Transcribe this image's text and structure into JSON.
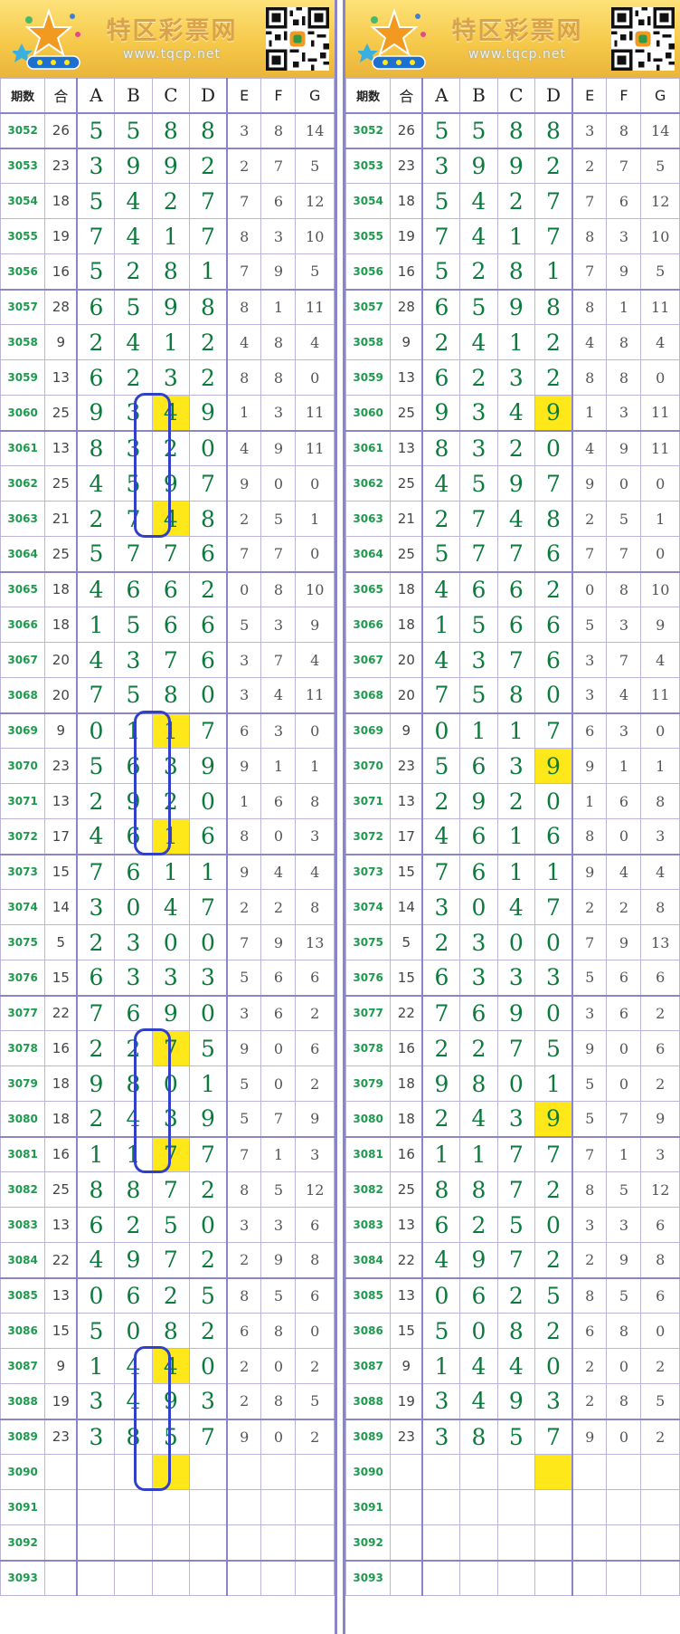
{
  "site": {
    "name": "特区彩票网",
    "url": "www.tqcp.net"
  },
  "headers": [
    "期数",
    "合",
    "A",
    "B",
    "C",
    "D",
    "E",
    "F",
    "G"
  ],
  "colors": {
    "accent_border": "#8a84c8",
    "highlight": "#ffe81a",
    "oval": "#3040c8",
    "period": "#1e9a4e",
    "digit": "#0c7a3c"
  },
  "rows": [
    {
      "p": "3052",
      "s": "26",
      "v": [
        "5",
        "5",
        "8",
        "8",
        "3",
        "8",
        "14"
      ]
    },
    {
      "p": "3053",
      "s": "23",
      "v": [
        "3",
        "9",
        "9",
        "2",
        "2",
        "7",
        "5"
      ]
    },
    {
      "p": "3054",
      "s": "18",
      "v": [
        "5",
        "4",
        "2",
        "7",
        "7",
        "6",
        "12"
      ]
    },
    {
      "p": "3055",
      "s": "19",
      "v": [
        "7",
        "4",
        "1",
        "7",
        "8",
        "3",
        "10"
      ]
    },
    {
      "p": "3056",
      "s": "16",
      "v": [
        "5",
        "2",
        "8",
        "1",
        "7",
        "9",
        "5"
      ]
    },
    {
      "p": "3057",
      "s": "28",
      "v": [
        "6",
        "5",
        "9",
        "8",
        "8",
        "1",
        "11"
      ]
    },
    {
      "p": "3058",
      "s": "9",
      "v": [
        "2",
        "4",
        "1",
        "2",
        "4",
        "8",
        "4"
      ]
    },
    {
      "p": "3059",
      "s": "13",
      "v": [
        "6",
        "2",
        "3",
        "2",
        "8",
        "8",
        "0"
      ]
    },
    {
      "p": "3060",
      "s": "25",
      "v": [
        "9",
        "3",
        "4",
        "9",
        "1",
        "3",
        "11"
      ]
    },
    {
      "p": "3061",
      "s": "13",
      "v": [
        "8",
        "3",
        "2",
        "0",
        "4",
        "9",
        "11"
      ]
    },
    {
      "p": "3062",
      "s": "25",
      "v": [
        "4",
        "5",
        "9",
        "7",
        "9",
        "0",
        "0"
      ]
    },
    {
      "p": "3063",
      "s": "21",
      "v": [
        "2",
        "7",
        "4",
        "8",
        "2",
        "5",
        "1"
      ]
    },
    {
      "p": "3064",
      "s": "25",
      "v": [
        "5",
        "7",
        "7",
        "6",
        "7",
        "7",
        "0"
      ]
    },
    {
      "p": "3065",
      "s": "18",
      "v": [
        "4",
        "6",
        "6",
        "2",
        "0",
        "8",
        "10"
      ]
    },
    {
      "p": "3066",
      "s": "18",
      "v": [
        "1",
        "5",
        "6",
        "6",
        "5",
        "3",
        "9"
      ]
    },
    {
      "p": "3067",
      "s": "20",
      "v": [
        "4",
        "3",
        "7",
        "6",
        "3",
        "7",
        "4"
      ]
    },
    {
      "p": "3068",
      "s": "20",
      "v": [
        "7",
        "5",
        "8",
        "0",
        "3",
        "4",
        "11"
      ]
    },
    {
      "p": "3069",
      "s": "9",
      "v": [
        "0",
        "1",
        "1",
        "7",
        "6",
        "3",
        "0"
      ]
    },
    {
      "p": "3070",
      "s": "23",
      "v": [
        "5",
        "6",
        "3",
        "9",
        "9",
        "1",
        "1"
      ]
    },
    {
      "p": "3071",
      "s": "13",
      "v": [
        "2",
        "9",
        "2",
        "0",
        "1",
        "6",
        "8"
      ]
    },
    {
      "p": "3072",
      "s": "17",
      "v": [
        "4",
        "6",
        "1",
        "6",
        "8",
        "0",
        "3"
      ]
    },
    {
      "p": "3073",
      "s": "15",
      "v": [
        "7",
        "6",
        "1",
        "1",
        "9",
        "4",
        "4"
      ]
    },
    {
      "p": "3074",
      "s": "14",
      "v": [
        "3",
        "0",
        "4",
        "7",
        "2",
        "2",
        "8"
      ]
    },
    {
      "p": "3075",
      "s": "5",
      "v": [
        "2",
        "3",
        "0",
        "0",
        "7",
        "9",
        "13"
      ]
    },
    {
      "p": "3076",
      "s": "15",
      "v": [
        "6",
        "3",
        "3",
        "3",
        "5",
        "6",
        "6"
      ]
    },
    {
      "p": "3077",
      "s": "22",
      "v": [
        "7",
        "6",
        "9",
        "0",
        "3",
        "6",
        "2"
      ]
    },
    {
      "p": "3078",
      "s": "16",
      "v": [
        "2",
        "2",
        "7",
        "5",
        "9",
        "0",
        "6"
      ]
    },
    {
      "p": "3079",
      "s": "18",
      "v": [
        "9",
        "8",
        "0",
        "1",
        "5",
        "0",
        "2"
      ]
    },
    {
      "p": "3080",
      "s": "18",
      "v": [
        "2",
        "4",
        "3",
        "9",
        "5",
        "7",
        "9"
      ]
    },
    {
      "p": "3081",
      "s": "16",
      "v": [
        "1",
        "1",
        "7",
        "7",
        "7",
        "1",
        "3"
      ]
    },
    {
      "p": "3082",
      "s": "25",
      "v": [
        "8",
        "8",
        "7",
        "2",
        "8",
        "5",
        "12"
      ]
    },
    {
      "p": "3083",
      "s": "13",
      "v": [
        "6",
        "2",
        "5",
        "0",
        "3",
        "3",
        "6"
      ]
    },
    {
      "p": "3084",
      "s": "22",
      "v": [
        "4",
        "9",
        "7",
        "2",
        "2",
        "9",
        "8"
      ]
    },
    {
      "p": "3085",
      "s": "13",
      "v": [
        "0",
        "6",
        "2",
        "5",
        "8",
        "5",
        "6"
      ]
    },
    {
      "p": "3086",
      "s": "15",
      "v": [
        "5",
        "0",
        "8",
        "2",
        "6",
        "8",
        "0"
      ]
    },
    {
      "p": "3087",
      "s": "9",
      "v": [
        "1",
        "4",
        "4",
        "0",
        "2",
        "0",
        "2"
      ]
    },
    {
      "p": "3088",
      "s": "19",
      "v": [
        "3",
        "4",
        "9",
        "3",
        "2",
        "8",
        "5"
      ]
    },
    {
      "p": "3089",
      "s": "23",
      "v": [
        "3",
        "8",
        "5",
        "7",
        "9",
        "0",
        "2"
      ]
    },
    {
      "p": "3090",
      "s": "",
      "v": [
        "",
        "",
        "",
        "",
        "",
        "",
        ""
      ]
    },
    {
      "p": "3091",
      "s": "",
      "v": [
        "",
        "",
        "",
        "",
        "",
        "",
        ""
      ]
    },
    {
      "p": "3092",
      "s": "",
      "v": [
        "",
        "",
        "",
        "",
        "",
        "",
        ""
      ]
    },
    {
      "p": "3093",
      "s": "",
      "v": [
        "",
        "",
        "",
        "",
        "",
        "",
        ""
      ]
    }
  ],
  "highlights_left": [
    [
      8,
      4
    ],
    [
      11,
      4
    ],
    [
      17,
      4
    ],
    [
      20,
      4
    ],
    [
      26,
      4
    ],
    [
      29,
      4
    ],
    [
      35,
      4
    ],
    [
      38,
      4
    ]
  ],
  "highlights_right": [
    [
      8,
      5
    ],
    [
      18,
      5
    ],
    [
      28,
      5
    ],
    [
      38,
      5
    ]
  ],
  "ovals_left": [
    [
      8,
      11
    ],
    [
      17,
      20
    ],
    [
      26,
      29
    ],
    [
      35,
      38
    ]
  ]
}
